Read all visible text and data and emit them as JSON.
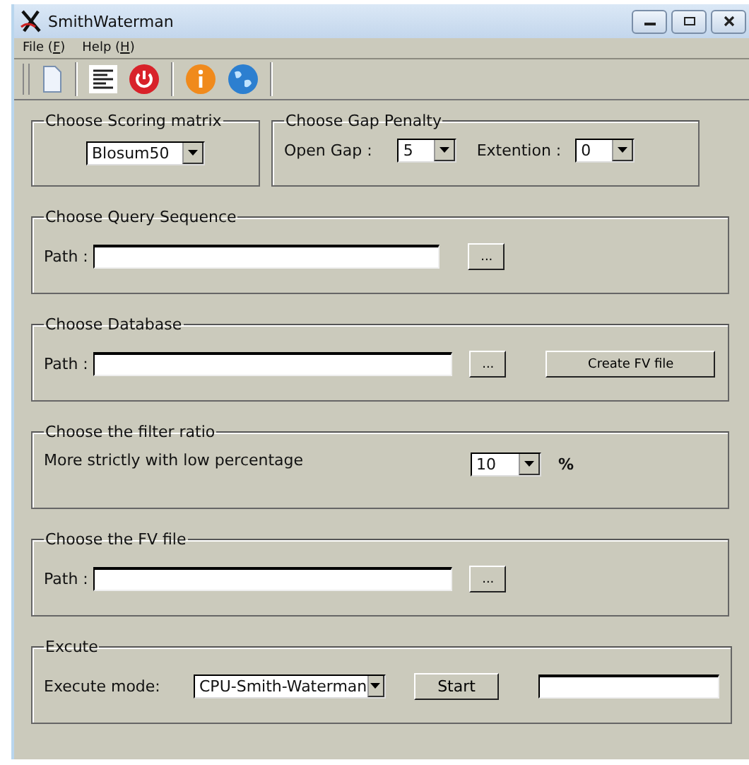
{
  "window": {
    "title": "SmithWaterman"
  },
  "menu": [
    {
      "label": "File (F)"
    },
    {
      "label": "Help (H)"
    }
  ],
  "scoring": {
    "title": "Choose Scoring matrix",
    "value": "Blosum50"
  },
  "gap": {
    "title": "Choose Gap Penalty",
    "open_label": "Open Gap :",
    "open_value": "5",
    "ext_label": "Extention  :",
    "ext_value": "0"
  },
  "query": {
    "title": "Choose Query Sequence",
    "path_label": "Path :",
    "browse": "..."
  },
  "database": {
    "title": "Choose Database",
    "path_label": "Path :",
    "browse": "...",
    "create": "Create FV file"
  },
  "filter": {
    "title": "Choose the filter ratio",
    "text": "More strictly with low percentage",
    "value": "10",
    "unit": "%"
  },
  "fv": {
    "title": "Choose the FV file",
    "path_label": "Path :",
    "browse": "..."
  },
  "execute": {
    "title": "Excute",
    "mode_label": "Execute mode:",
    "mode_value": "CPU-Smith-Waterman",
    "start": "Start"
  }
}
